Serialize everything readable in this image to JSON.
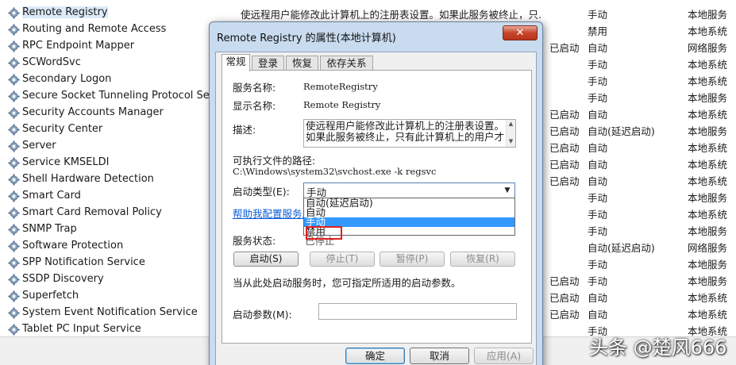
{
  "services": [
    {
      "name": "Remote Registry",
      "desc": "使远程用户能修改此计算机上的注册表设置。如果此服务被终止，只...",
      "status": "",
      "startup": "手动",
      "logon": "本地服务",
      "selected": true
    },
    {
      "name": "Routing and Remote Access",
      "desc": "",
      "status": "",
      "startup": "禁用",
      "logon": "本地系统"
    },
    {
      "name": "RPC Endpoint Mapper",
      "desc": "",
      "status": "已启动",
      "startup": "自动",
      "logon": "网络服务"
    },
    {
      "name": "SCWordSvc",
      "desc": "",
      "status": "",
      "startup": "手动",
      "logon": "本地系统"
    },
    {
      "name": "Secondary Logon",
      "desc": "",
      "status": "",
      "startup": "手动",
      "logon": "本地系统"
    },
    {
      "name": "Secure Socket Tunneling Protocol Service",
      "desc": "",
      "status": "",
      "startup": "手动",
      "logon": "本地服务"
    },
    {
      "name": "Security Accounts Manager",
      "desc": "",
      "status": "已启动",
      "startup": "自动",
      "logon": "本地系统"
    },
    {
      "name": "Security Center",
      "desc": "",
      "status": "已启动",
      "startup": "自动(延迟启动)",
      "logon": "本地服务"
    },
    {
      "name": "Server",
      "desc": "",
      "status": "已启动",
      "startup": "自动",
      "logon": "本地系统"
    },
    {
      "name": "Service KMSELDI",
      "desc": "",
      "status": "已启动",
      "startup": "自动",
      "logon": "本地系统"
    },
    {
      "name": "Shell Hardware Detection",
      "desc": "",
      "status": "已启动",
      "startup": "自动",
      "logon": "本地系统"
    },
    {
      "name": "Smart Card",
      "desc": "",
      "status": "",
      "startup": "手动",
      "logon": "本地服务"
    },
    {
      "name": "Smart Card Removal Policy",
      "desc": "",
      "status": "",
      "startup": "手动",
      "logon": "本地系统"
    },
    {
      "name": "SNMP Trap",
      "desc": "",
      "status": "",
      "startup": "手动",
      "logon": "本地服务"
    },
    {
      "name": "Software Protection",
      "desc": "",
      "status": "",
      "startup": "自动(延迟启动)",
      "logon": "网络服务"
    },
    {
      "name": "SPP Notification Service",
      "desc": "",
      "status": "",
      "startup": "手动",
      "logon": "本地服务"
    },
    {
      "name": "SSDP Discovery",
      "desc": "",
      "status": "已启动",
      "startup": "手动",
      "logon": "本地服务"
    },
    {
      "name": "Superfetch",
      "desc": "",
      "status": "已启动",
      "startup": "自动",
      "logon": "本地系统"
    },
    {
      "name": "System Event Notification Service",
      "desc": "",
      "status": "已启动",
      "startup": "自动",
      "logon": "本地系统"
    },
    {
      "name": "Tablet PC Input Service",
      "desc": "",
      "status": "",
      "startup": "手动",
      "logon": "本地系统"
    }
  ],
  "dialog": {
    "title": "Remote Registry 的属性(本地计算机)",
    "close_glyph": "✕",
    "tabs": [
      "常规",
      "登录",
      "恢复",
      "依存关系"
    ],
    "service_name_label": "服务名称:",
    "service_name": "RemoteRegistry",
    "display_name_label": "显示名称:",
    "display_name": "Remote Registry",
    "description_label": "描述:",
    "description": "使远程用户能修改此计算机上的注册表设置。如果此服务被终止，只有此计算机上的用户才",
    "exe_path_label": "可执行文件的路径:",
    "exe_path": "C:\\Windows\\system32\\svchost.exe -k regsvc",
    "startup_type_label": "启动类型(E):",
    "startup_type_value": "手动",
    "startup_options": [
      "自动(延迟启动)",
      "自动",
      "手动",
      "禁用"
    ],
    "startup_highlighted": "手动",
    "help_link": "帮助我配置服务启",
    "status_label": "服务状态:",
    "status_value": "已停止",
    "start_btn": "启动(S)",
    "stop_btn": "停止(T)",
    "pause_btn": "暂停(P)",
    "resume_btn": "恢复(R)",
    "hint": "当从此处启动服务时，您可指定所适用的启动参数。",
    "params_label": "启动参数(M):",
    "params_value": "",
    "ok_btn": "确定",
    "cancel_btn": "取消",
    "apply_btn": "应用(A)"
  },
  "watermark": "头条 @楚风666",
  "colors": {
    "selection_highlight": "#3399ff",
    "annotation_red": "#e02020",
    "link": "#0b5bd8"
  }
}
